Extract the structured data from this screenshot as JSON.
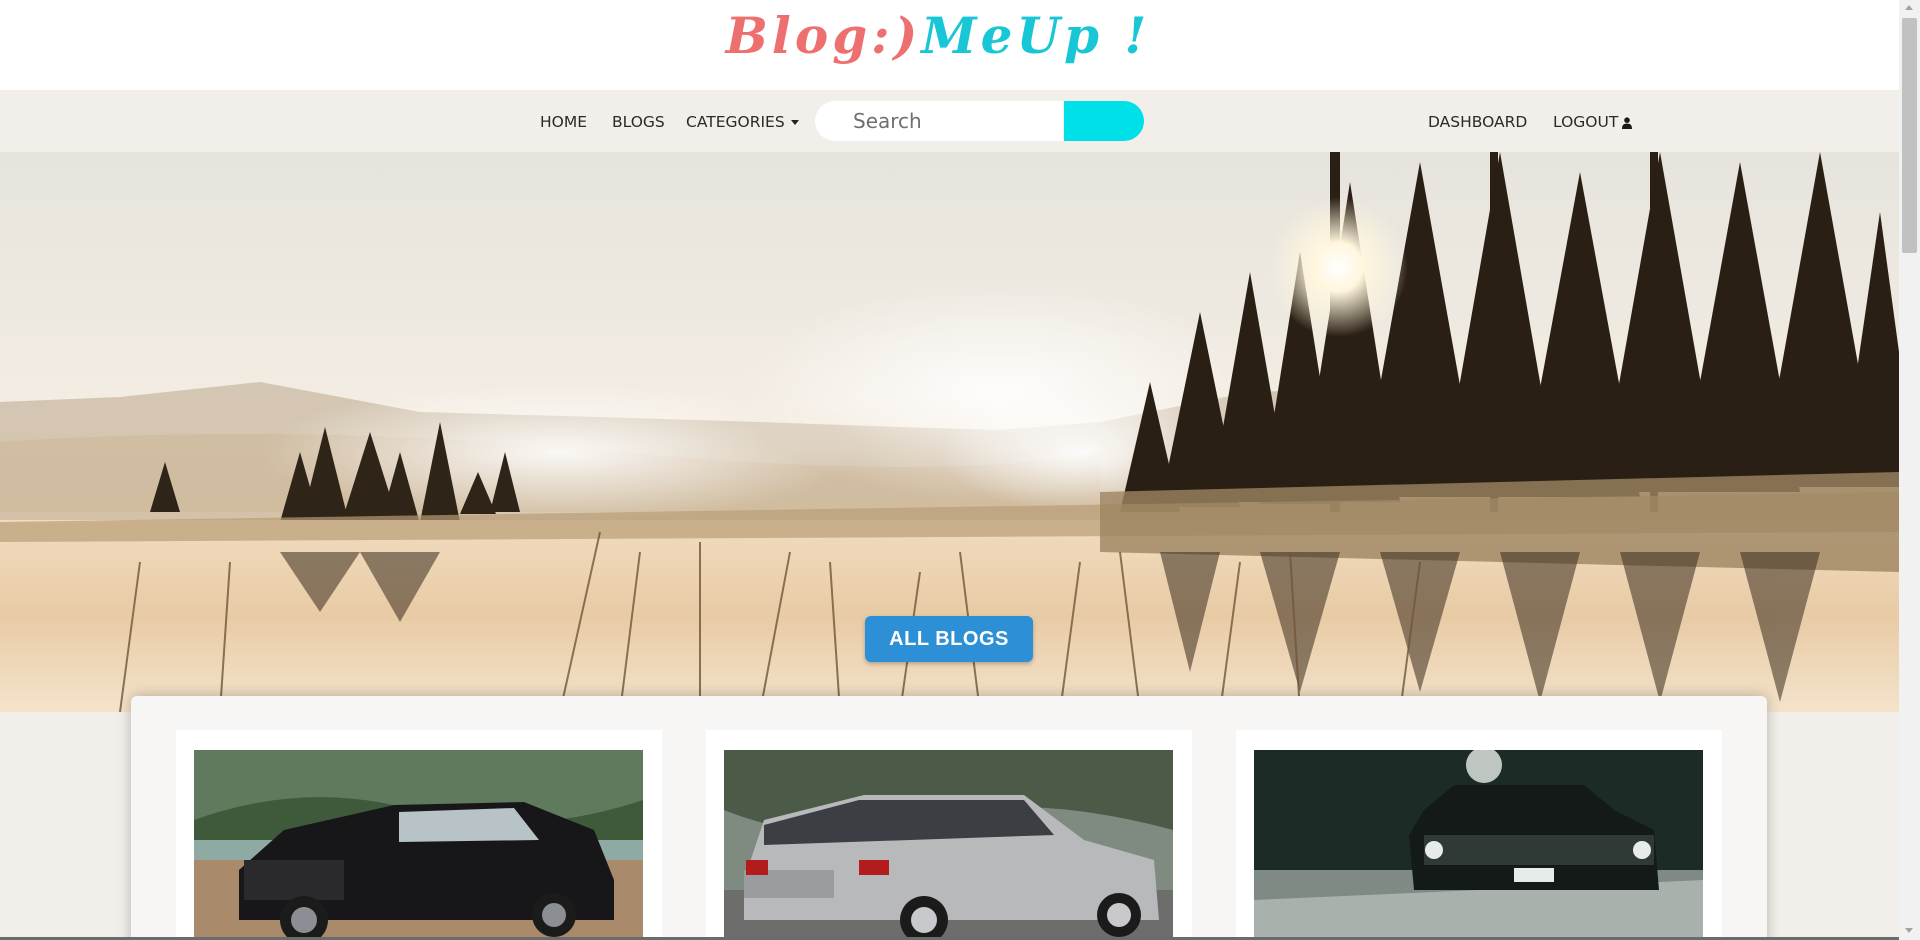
{
  "header": {
    "logo_part1": "Blog:)",
    "logo_part2": "MeUp !",
    "colors": {
      "logo_part1": "#ee6f6f",
      "logo_part2": "#19c6d6"
    }
  },
  "nav": {
    "home": "HOME",
    "blogs": "BLOGS",
    "categories": "CATEGORIES",
    "search_placeholder": "Search",
    "dashboard": "DASHBOARD",
    "logout": "LOGOUT",
    "icons": {
      "categories": "caret-down-icon",
      "logout": "user-icon"
    },
    "colors": {
      "search_button": "#00e0e8"
    }
  },
  "hero": {
    "image": "misty lake with pine forest at sunrise",
    "button_label": "ALL BLOGS",
    "colors": {
      "button": "#2d8fd6"
    }
  },
  "cards": [
    {
      "image": "black suv"
    },
    {
      "image": "silver suv"
    },
    {
      "image": "vintage car at night"
    }
  ]
}
